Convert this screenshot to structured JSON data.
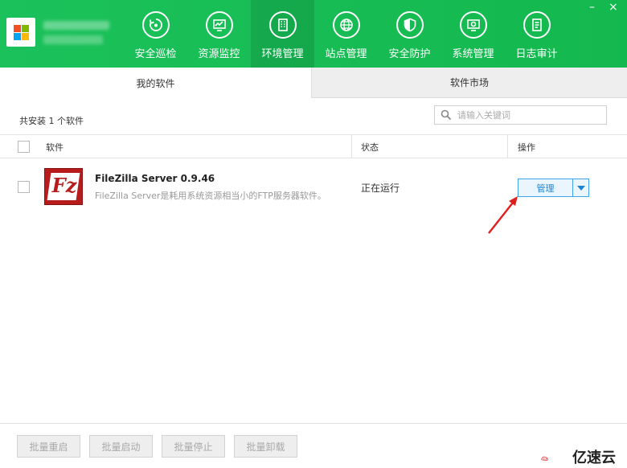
{
  "header": {
    "nav": [
      {
        "label": "安全巡检",
        "icon": "shield-refresh-icon"
      },
      {
        "label": "资源监控",
        "icon": "monitor-chart-icon"
      },
      {
        "label": "环境管理",
        "icon": "building-icon",
        "active": true
      },
      {
        "label": "站点管理",
        "icon": "globe-icon"
      },
      {
        "label": "安全防护",
        "icon": "shield-icon"
      },
      {
        "label": "系统管理",
        "icon": "gear-screen-icon"
      },
      {
        "label": "日志审计",
        "icon": "document-icon"
      }
    ],
    "window_controls": {
      "minimize": "–",
      "close": "×"
    }
  },
  "tabs": {
    "mine": "我的软件",
    "market": "软件市场"
  },
  "summary": {
    "installed_count": "共安装 1 个软件"
  },
  "search": {
    "placeholder": "请输入关键词"
  },
  "table": {
    "headers": {
      "software": "软件",
      "status": "状态",
      "action": "操作"
    },
    "rows": [
      {
        "name": "FileZilla Server 0.9.46",
        "description": "FileZilla Server是耗用系统资源相当小的FTP服务器软件。",
        "status": "正在运行",
        "icon_letter": "Fz",
        "action_label": "管理"
      }
    ]
  },
  "footer": {
    "buttons": [
      "批量重启",
      "批量启动",
      "批量停止",
      "批量卸载"
    ]
  },
  "watermark": {
    "text": "亿速云"
  },
  "colors": {
    "header_green": "#1bc15a",
    "accent_blue": "#1a84d3",
    "arrow_red": "#e02020"
  }
}
